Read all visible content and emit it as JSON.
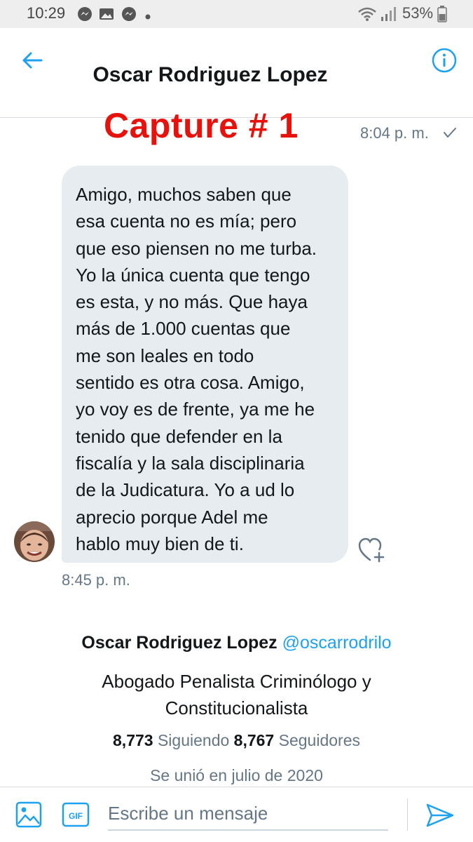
{
  "status_bar": {
    "time": "10:29",
    "battery": "53%",
    "icons": [
      "messenger-icon",
      "gallery-icon",
      "messenger-icon",
      "dot-icon",
      "wifi-icon",
      "signal-icon",
      "battery-icon"
    ]
  },
  "header": {
    "title": "Oscar Rodriguez Lopez",
    "back_icon": "arrow-left-icon",
    "info_icon": "info-icon"
  },
  "conversation": {
    "annotation": "Capture # 1",
    "sent_time": "8:04 p. m.",
    "message_lines": [
      "Amigo, muchos saben que",
      "esa cuenta no es mía; pero",
      "que eso piensen no me turba.",
      "Yo la única cuenta que tengo",
      "es esta, y no más. Que haya",
      "más de 1.000 cuentas que",
      "me son leales en todo",
      "sentido es otra cosa. Amigo,",
      "yo voy es de frente, ya me he",
      "tenido que defender en la",
      "fiscalía y la sala disciplinaria",
      "de la Judicatura. Yo a ud lo",
      "aprecio porque Adel me",
      "hablo muy bien de ti."
    ],
    "received_time": "8:45 p. m."
  },
  "profile": {
    "name": "Oscar Rodriguez Lopez",
    "handle": "@oscarrodrilo",
    "bio_lines": [
      "Abogado Penalista Criminólogo y",
      "Constitucionalista"
    ],
    "following_count": "8,773",
    "following_label": "Siguiendo",
    "followers_count": "8,767",
    "followers_label": "Seguidores",
    "joined": "Se unió en julio de 2020"
  },
  "composer": {
    "placeholder": "Escribe un mensaje",
    "gif_label": "GIF"
  },
  "colors": {
    "accent": "#1da1f2",
    "annotation": "#e8120c",
    "bubble": "#e6ecf0",
    "muted": "#657786"
  }
}
